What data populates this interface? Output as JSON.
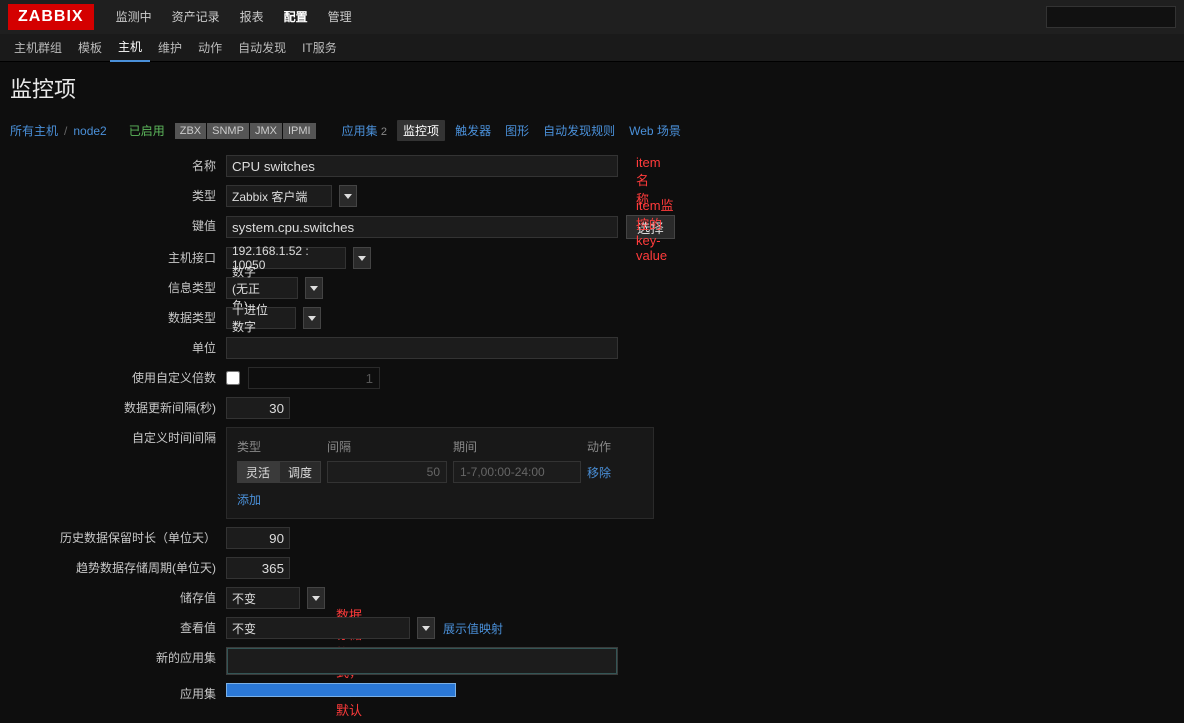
{
  "brand": "ZABBIX",
  "topnav": [
    "监测中",
    "资产记录",
    "报表",
    "配置",
    "管理"
  ],
  "topnav_active": 3,
  "subnav": [
    "主机群组",
    "模板",
    "主机",
    "维护",
    "动作",
    "自动发现",
    "IT服务"
  ],
  "subnav_active": 2,
  "page_title": "监控项",
  "crumb": {
    "all_hosts": "所有主机",
    "host": "node2",
    "enabled": "已启用",
    "tags": [
      "ZBX",
      "SNMP",
      "JMX",
      "IPMI"
    ],
    "tabs": [
      {
        "label": "应用集",
        "count": "2"
      },
      {
        "label": "监控项"
      },
      {
        "label": "触发器"
      },
      {
        "label": "图形"
      },
      {
        "label": "自动发现规则"
      },
      {
        "label": "Web 场景"
      }
    ],
    "tabs_active": 1
  },
  "fields": {
    "name_label": "名称",
    "name_value": "CPU switches",
    "type_label": "类型",
    "type_value": "Zabbix 客户端",
    "key_label": "键值",
    "key_value": "system.cpu.switches",
    "key_select_btn": "选择",
    "iface_label": "主机接口",
    "iface_value": "192.168.1.52 : 10050",
    "info_label": "信息类型",
    "info_value": "数字 (无正负)",
    "data_label": "数据类型",
    "data_value": "十进位数字",
    "unit_label": "单位",
    "unit_value": "",
    "mult_label": "使用自定义倍数",
    "mult_placeholder": "1",
    "upd_label": "数据更新间隔(秒)",
    "upd_value": "30",
    "cint_label": "自定义时间间隔",
    "hist_label": "历史数据保留时长（单位天）",
    "hist_value": "90",
    "trend_label": "趋势数据存储周期(单位天)",
    "trend_value": "365",
    "store_label": "储存值",
    "store_value": "不变",
    "view_label": "查看值",
    "view_value": "不变",
    "view_map": "展示值映射",
    "newapp_label": "新的应用集",
    "app_label": "应用集"
  },
  "custom_interval": {
    "h_type": "类型",
    "h_int": "间隔",
    "h_period": "期间",
    "h_action": "动作",
    "btn_flex": "灵活",
    "btn_dispatch": "调度",
    "int_value": "50",
    "period_value": "1-7,00:00-24:00",
    "remove": "移除",
    "add": "添加"
  },
  "annotations": {
    "name": "item名称",
    "key": "item监控的key-value",
    "store": "数据存储格式，一般默认"
  }
}
